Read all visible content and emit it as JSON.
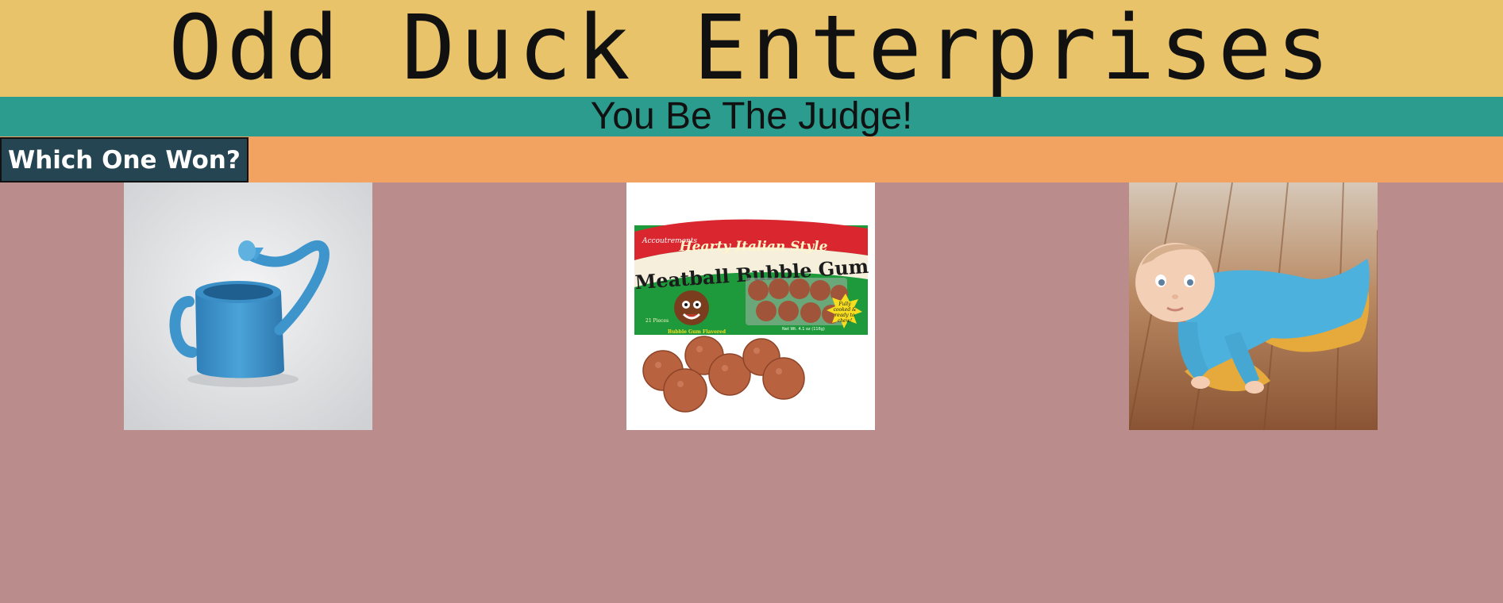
{
  "header": {
    "title": "Odd Duck Enterprises",
    "background_color": "#e8c36a"
  },
  "tagline_bar": {
    "text": "You Be The Judge!",
    "background_color": "#2b9c8e"
  },
  "nav": {
    "results_button_label": "Which One Won?",
    "background_color": "#f2a261",
    "button_color": "#264553"
  },
  "page": {
    "background_color": "#bb8c8c"
  },
  "products": [
    {
      "image_semantic": "inverted-watering-can-image"
    },
    {
      "image_semantic": "meatball-bubble-gum-image",
      "package_brand": "Accoutrements",
      "package_banner": "Hearty Italian Style",
      "package_title": "Meatball Bubble Gum",
      "package_count": "21 Pieces",
      "package_flavor": "Bubble Gum Flavored",
      "package_weight": "Net Wt. 4.1 oz (116g)",
      "package_starburst_line1": "Fully",
      "package_starburst_line2": "cooked &",
      "package_starburst_line3": "ready to",
      "package_starburst_line4": "chew!"
    },
    {
      "image_semantic": "baby-mop-onesie-image"
    }
  ]
}
